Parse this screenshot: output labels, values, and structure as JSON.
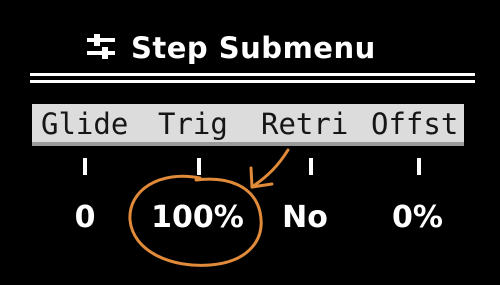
{
  "header": {
    "icon": "sliders-icon",
    "title": "Step Submenu"
  },
  "params": [
    {
      "label": "Glide",
      "value": "0"
    },
    {
      "label": "Trig",
      "value": "100%"
    },
    {
      "label": "Retri",
      "value": "No"
    },
    {
      "label": "Offst",
      "value": "0%"
    }
  ],
  "selected_param": "Glide",
  "colors": {
    "background": "#000000",
    "foreground": "#ffffff",
    "tab_bar_background": "#dcdcdc",
    "tab_bar_text": "#161616",
    "annotation": "#e08a3a"
  }
}
